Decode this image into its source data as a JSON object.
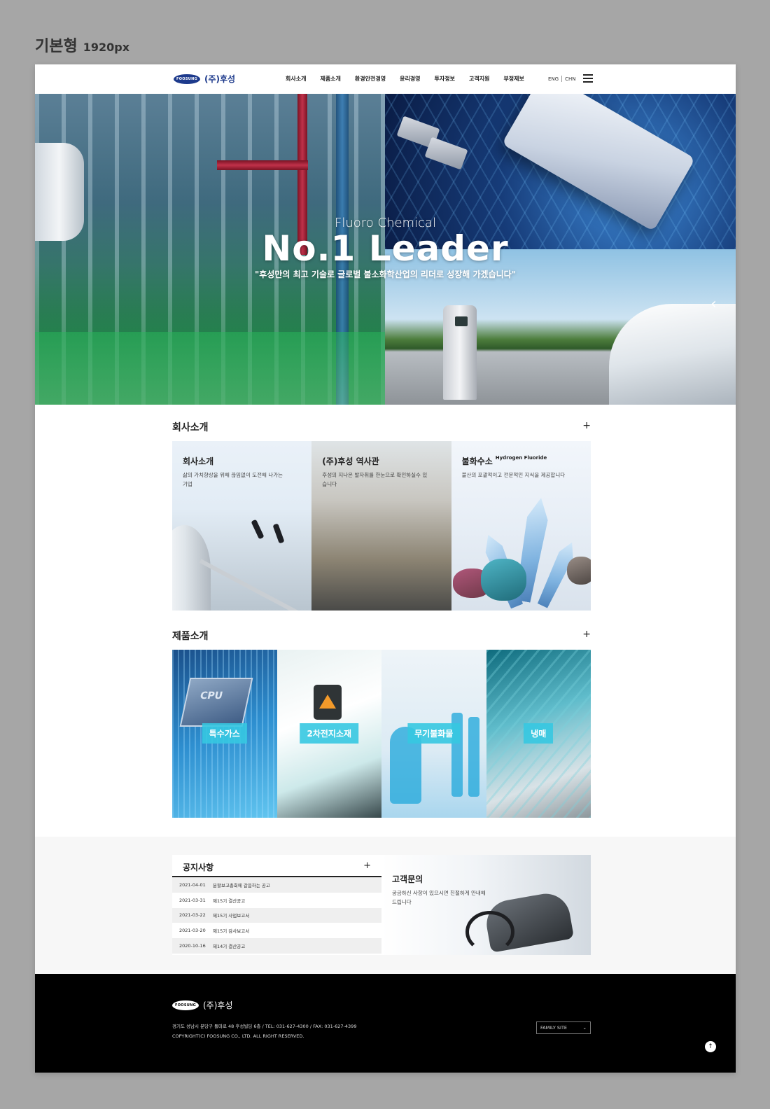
{
  "canvas_label": {
    "title": "기본형",
    "size": "1920px"
  },
  "header": {
    "logo_mark": "FOOSUNG",
    "logo_text": "(주)후성",
    "nav": [
      "회사소개",
      "제품소개",
      "환경안전경영",
      "윤리경영",
      "투자정보",
      "고객지원",
      "부정제보"
    ],
    "lang": [
      "ENG",
      "CHN"
    ]
  },
  "hero": {
    "subtitle": "Fluoro Chemical",
    "title": "No.1 Leader",
    "description": "\"후성만의 최고 기술로 글로벌 불소화학산업의 리더로 성장해 가겠습니다\""
  },
  "about": {
    "title": "회사소개",
    "plus": "+",
    "cards": [
      {
        "title": "회사소개",
        "title_sub": "",
        "desc": "삶의 가치향상을 위해 끊임없이 도전해 나가는 기업"
      },
      {
        "title": "(주)후성 역사관",
        "title_sub": "",
        "desc": "후성의 지나온 발자취를 한눈으로 확인하실수 있습니다"
      },
      {
        "title": "불화수소",
        "title_sub": "Hydrogen Fluoride",
        "desc": "불산의 포괄적이고 전문적인 지식을 제공합니다"
      }
    ]
  },
  "products": {
    "title": "제품소개",
    "plus": "+",
    "cards": [
      {
        "label": "특수가스",
        "image_text": "CPU"
      },
      {
        "label": "2차전지소재"
      },
      {
        "label": "무기불화물"
      },
      {
        "label": "냉매"
      }
    ]
  },
  "notice": {
    "title": "공지사항",
    "plus": "+",
    "rows": [
      {
        "date": "2021-04-01",
        "text": "분할보고총회에 갈음하는 공고"
      },
      {
        "date": "2021-03-31",
        "text": "제15기 결산공고"
      },
      {
        "date": "2021-03-22",
        "text": "제15기 사업보고서"
      },
      {
        "date": "2021-03-20",
        "text": "제15기 감사보고서"
      },
      {
        "date": "2020-10-16",
        "text": "제14기 결산공고"
      }
    ]
  },
  "contact": {
    "title": "고객문의",
    "desc": "궁금하신 사항이 있으시면 친절하게 안내해드립니다"
  },
  "footer": {
    "logo_mark": "FOOSUNG",
    "logo_text": "(주)후성",
    "address": "경기도 성남시 분당구 돌마로 48 후성빌딩 6층 / TEL: 031-627-4300 / FAX: 031-627-4399",
    "copyright": "COPYRIGHT(C) FOOSUNG CO., LTD. ALL RIGHT RESERVED.",
    "family_site": "FAMILY SITE",
    "top_icon": "arrow-up-icon"
  },
  "colors": {
    "brand": "#1d3a8c",
    "accent": "#36c8e1",
    "footer_bg": "#000000",
    "band_bg": "#f7f7f7"
  }
}
